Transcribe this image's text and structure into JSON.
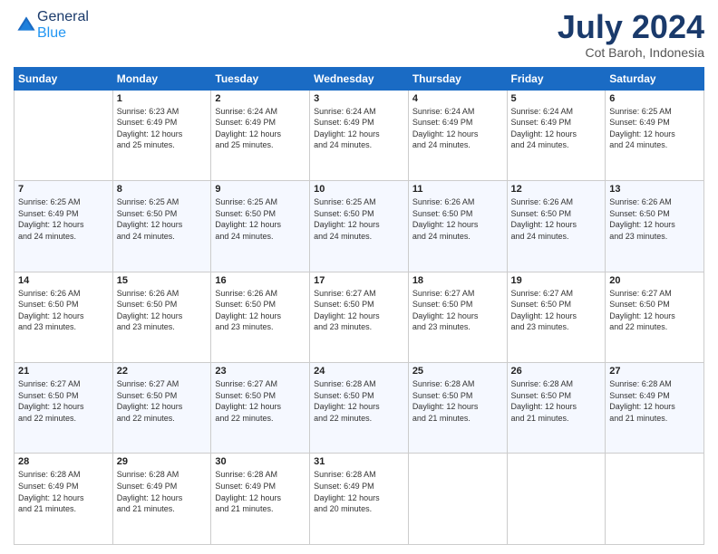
{
  "logo": {
    "general": "General",
    "blue": "Blue"
  },
  "header": {
    "month": "July 2024",
    "location": "Cot Baroh, Indonesia"
  },
  "weekdays": [
    "Sunday",
    "Monday",
    "Tuesday",
    "Wednesday",
    "Thursday",
    "Friday",
    "Saturday"
  ],
  "weeks": [
    [
      {
        "day": "",
        "info": ""
      },
      {
        "day": "1",
        "info": "Sunrise: 6:23 AM\nSunset: 6:49 PM\nDaylight: 12 hours\nand 25 minutes."
      },
      {
        "day": "2",
        "info": "Sunrise: 6:24 AM\nSunset: 6:49 PM\nDaylight: 12 hours\nand 25 minutes."
      },
      {
        "day": "3",
        "info": "Sunrise: 6:24 AM\nSunset: 6:49 PM\nDaylight: 12 hours\nand 24 minutes."
      },
      {
        "day": "4",
        "info": "Sunrise: 6:24 AM\nSunset: 6:49 PM\nDaylight: 12 hours\nand 24 minutes."
      },
      {
        "day": "5",
        "info": "Sunrise: 6:24 AM\nSunset: 6:49 PM\nDaylight: 12 hours\nand 24 minutes."
      },
      {
        "day": "6",
        "info": "Sunrise: 6:25 AM\nSunset: 6:49 PM\nDaylight: 12 hours\nand 24 minutes."
      }
    ],
    [
      {
        "day": "7",
        "info": "Sunrise: 6:25 AM\nSunset: 6:49 PM\nDaylight: 12 hours\nand 24 minutes."
      },
      {
        "day": "8",
        "info": "Sunrise: 6:25 AM\nSunset: 6:50 PM\nDaylight: 12 hours\nand 24 minutes."
      },
      {
        "day": "9",
        "info": "Sunrise: 6:25 AM\nSunset: 6:50 PM\nDaylight: 12 hours\nand 24 minutes."
      },
      {
        "day": "10",
        "info": "Sunrise: 6:25 AM\nSunset: 6:50 PM\nDaylight: 12 hours\nand 24 minutes."
      },
      {
        "day": "11",
        "info": "Sunrise: 6:26 AM\nSunset: 6:50 PM\nDaylight: 12 hours\nand 24 minutes."
      },
      {
        "day": "12",
        "info": "Sunrise: 6:26 AM\nSunset: 6:50 PM\nDaylight: 12 hours\nand 24 minutes."
      },
      {
        "day": "13",
        "info": "Sunrise: 6:26 AM\nSunset: 6:50 PM\nDaylight: 12 hours\nand 23 minutes."
      }
    ],
    [
      {
        "day": "14",
        "info": "Sunrise: 6:26 AM\nSunset: 6:50 PM\nDaylight: 12 hours\nand 23 minutes."
      },
      {
        "day": "15",
        "info": "Sunrise: 6:26 AM\nSunset: 6:50 PM\nDaylight: 12 hours\nand 23 minutes."
      },
      {
        "day": "16",
        "info": "Sunrise: 6:26 AM\nSunset: 6:50 PM\nDaylight: 12 hours\nand 23 minutes."
      },
      {
        "day": "17",
        "info": "Sunrise: 6:27 AM\nSunset: 6:50 PM\nDaylight: 12 hours\nand 23 minutes."
      },
      {
        "day": "18",
        "info": "Sunrise: 6:27 AM\nSunset: 6:50 PM\nDaylight: 12 hours\nand 23 minutes."
      },
      {
        "day": "19",
        "info": "Sunrise: 6:27 AM\nSunset: 6:50 PM\nDaylight: 12 hours\nand 23 minutes."
      },
      {
        "day": "20",
        "info": "Sunrise: 6:27 AM\nSunset: 6:50 PM\nDaylight: 12 hours\nand 22 minutes."
      }
    ],
    [
      {
        "day": "21",
        "info": "Sunrise: 6:27 AM\nSunset: 6:50 PM\nDaylight: 12 hours\nand 22 minutes."
      },
      {
        "day": "22",
        "info": "Sunrise: 6:27 AM\nSunset: 6:50 PM\nDaylight: 12 hours\nand 22 minutes."
      },
      {
        "day": "23",
        "info": "Sunrise: 6:27 AM\nSunset: 6:50 PM\nDaylight: 12 hours\nand 22 minutes."
      },
      {
        "day": "24",
        "info": "Sunrise: 6:28 AM\nSunset: 6:50 PM\nDaylight: 12 hours\nand 22 minutes."
      },
      {
        "day": "25",
        "info": "Sunrise: 6:28 AM\nSunset: 6:50 PM\nDaylight: 12 hours\nand 21 minutes."
      },
      {
        "day": "26",
        "info": "Sunrise: 6:28 AM\nSunset: 6:50 PM\nDaylight: 12 hours\nand 21 minutes."
      },
      {
        "day": "27",
        "info": "Sunrise: 6:28 AM\nSunset: 6:49 PM\nDaylight: 12 hours\nand 21 minutes."
      }
    ],
    [
      {
        "day": "28",
        "info": "Sunrise: 6:28 AM\nSunset: 6:49 PM\nDaylight: 12 hours\nand 21 minutes."
      },
      {
        "day": "29",
        "info": "Sunrise: 6:28 AM\nSunset: 6:49 PM\nDaylight: 12 hours\nand 21 minutes."
      },
      {
        "day": "30",
        "info": "Sunrise: 6:28 AM\nSunset: 6:49 PM\nDaylight: 12 hours\nand 21 minutes."
      },
      {
        "day": "31",
        "info": "Sunrise: 6:28 AM\nSunset: 6:49 PM\nDaylight: 12 hours\nand 20 minutes."
      },
      {
        "day": "",
        "info": ""
      },
      {
        "day": "",
        "info": ""
      },
      {
        "day": "",
        "info": ""
      }
    ]
  ]
}
